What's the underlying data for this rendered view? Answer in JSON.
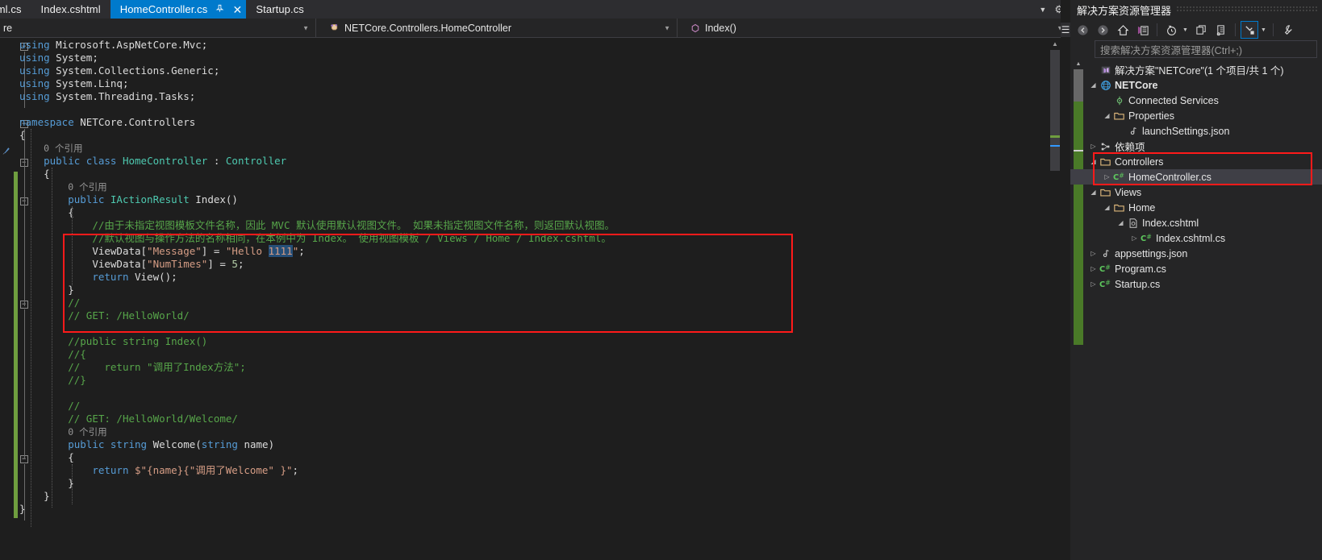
{
  "tabs": [
    {
      "label": "tml.cs",
      "active": false,
      "pinned": false,
      "closable": false
    },
    {
      "label": "Index.cshtml",
      "active": false,
      "pinned": false,
      "closable": false
    },
    {
      "label": "HomeController.cs",
      "active": true,
      "pinned": true,
      "closable": true
    },
    {
      "label": "Startup.cs",
      "active": false,
      "pinned": false,
      "closable": false
    }
  ],
  "tabstrip": {
    "overflow_caret": "chevron-down-icon",
    "gear": "gear-icon"
  },
  "navbar": {
    "project": "re",
    "type": "NETCore.Controllers.HomeController",
    "member": "Index()"
  },
  "code": {
    "lines": [
      {
        "indent": 0,
        "fold": true,
        "tokens": [
          {
            "c": "k",
            "t": "using"
          },
          {
            "c": "p",
            "t": " Microsoft.AspNetCore.Mvc;"
          }
        ]
      },
      {
        "indent": 0,
        "tokens": [
          {
            "c": "k",
            "t": "using"
          },
          {
            "c": "p",
            "t": " System;"
          }
        ]
      },
      {
        "indent": 0,
        "tokens": [
          {
            "c": "k",
            "t": "using"
          },
          {
            "c": "p",
            "t": " System.Collections.Generic;"
          }
        ]
      },
      {
        "indent": 0,
        "tokens": [
          {
            "c": "k",
            "t": "using"
          },
          {
            "c": "p",
            "t": " System.Linq;"
          }
        ]
      },
      {
        "indent": 0,
        "tokens": [
          {
            "c": "k",
            "t": "using"
          },
          {
            "c": "p",
            "t": " System.Threading.Tasks;"
          }
        ]
      },
      {
        "indent": 0,
        "tokens": []
      },
      {
        "indent": 0,
        "fold": true,
        "tokens": [
          {
            "c": "k",
            "t": "namespace"
          },
          {
            "c": "p",
            "t": " NETCore.Controllers"
          }
        ]
      },
      {
        "indent": 0,
        "tokens": [
          {
            "c": "p",
            "t": "{"
          }
        ]
      },
      {
        "indent": 1,
        "tokens": [
          {
            "c": "ref",
            "t": "0 个引用"
          }
        ]
      },
      {
        "indent": 1,
        "fold": true,
        "tokens": [
          {
            "c": "k",
            "t": "public"
          },
          {
            "c": "p",
            "t": " "
          },
          {
            "c": "k",
            "t": "class"
          },
          {
            "c": "p",
            "t": " "
          },
          {
            "c": "t",
            "t": "HomeController"
          },
          {
            "c": "p",
            "t": " : "
          },
          {
            "c": "t",
            "t": "Controller"
          }
        ]
      },
      {
        "indent": 1,
        "tokens": [
          {
            "c": "p",
            "t": "{"
          }
        ]
      },
      {
        "indent": 2,
        "tokens": [
          {
            "c": "ref",
            "t": "0 个引用"
          }
        ]
      },
      {
        "indent": 2,
        "tokens": [
          {
            "c": "k",
            "t": "public"
          },
          {
            "c": "p",
            "t": " "
          },
          {
            "c": "t",
            "t": "IActionResult"
          },
          {
            "c": "p",
            "t": " Index()"
          }
        ]
      },
      {
        "indent": 2,
        "tokens": [
          {
            "c": "p",
            "t": "{"
          }
        ]
      },
      {
        "indent": 3,
        "tokens": [
          {
            "c": "c",
            "t": "//由于未指定视图模板文件名称，因此 MVC 默认使用默认视图文件。 如果未指定视图文件名称，则返回默认视图。"
          }
        ]
      },
      {
        "indent": 3,
        "tokens": [
          {
            "c": "c",
            "t": "//默认视图与操作方法的名称相同，在本例中为 Index。 使用视图模板 / Views / Home / Index.cshtml。"
          }
        ]
      },
      {
        "indent": 3,
        "tokens": [
          {
            "c": "p",
            "t": "ViewData["
          },
          {
            "c": "s",
            "t": "\"Message\""
          },
          {
            "c": "p",
            "t": "] = "
          },
          {
            "c": "s",
            "t": "\"Hello "
          },
          {
            "c": "sel",
            "t": "1111"
          },
          {
            "c": "s",
            "t": "\""
          },
          {
            "c": "p",
            "t": ";"
          }
        ]
      },
      {
        "indent": 3,
        "tokens": [
          {
            "c": "p",
            "t": "ViewData["
          },
          {
            "c": "s",
            "t": "\"NumTimes\""
          },
          {
            "c": "p",
            "t": "] = "
          },
          {
            "c": "n",
            "t": "5"
          },
          {
            "c": "p",
            "t": ";"
          }
        ]
      },
      {
        "indent": 3,
        "tokens": [
          {
            "c": "k",
            "t": "return"
          },
          {
            "c": "p",
            "t": " View();"
          }
        ]
      },
      {
        "indent": 2,
        "tokens": [
          {
            "c": "p",
            "t": "}"
          }
        ]
      },
      {
        "indent": 2,
        "tokens": [
          {
            "c": "c",
            "t": "//"
          }
        ]
      },
      {
        "indent": 2,
        "tokens": [
          {
            "c": "c",
            "t": "// GET: /HelloWorld/"
          }
        ]
      },
      {
        "indent": 2,
        "tokens": []
      },
      {
        "indent": 2,
        "tokens": [
          {
            "c": "c",
            "t": "//public string Index()"
          }
        ]
      },
      {
        "indent": 2,
        "tokens": [
          {
            "c": "c",
            "t": "//{"
          }
        ]
      },
      {
        "indent": 2,
        "tokens": [
          {
            "c": "c",
            "t": "//    return \"调用了Index方法\";"
          }
        ]
      },
      {
        "indent": 2,
        "tokens": [
          {
            "c": "c",
            "t": "//}"
          }
        ]
      },
      {
        "indent": 2,
        "tokens": []
      },
      {
        "indent": 2,
        "tokens": [
          {
            "c": "c",
            "t": "//"
          }
        ]
      },
      {
        "indent": 2,
        "tokens": [
          {
            "c": "c",
            "t": "// GET: /HelloWorld/Welcome/"
          }
        ]
      },
      {
        "indent": 2,
        "tokens": [
          {
            "c": "ref",
            "t": "0 个引用"
          }
        ]
      },
      {
        "indent": 2,
        "fold": true,
        "tokens": [
          {
            "c": "k",
            "t": "public"
          },
          {
            "c": "p",
            "t": " "
          },
          {
            "c": "k",
            "t": "string"
          },
          {
            "c": "p",
            "t": " Welcome("
          },
          {
            "c": "k",
            "t": "string"
          },
          {
            "c": "p",
            "t": " name)"
          }
        ]
      },
      {
        "indent": 2,
        "tokens": [
          {
            "c": "p",
            "t": "{"
          }
        ]
      },
      {
        "indent": 3,
        "tokens": [
          {
            "c": "k",
            "t": "return"
          },
          {
            "c": "p",
            "t": " "
          },
          {
            "c": "s",
            "t": "$\"{name}{\"调用了Welcome\" }\""
          },
          {
            "c": "p",
            "t": ";"
          }
        ]
      },
      {
        "indent": 2,
        "tokens": [
          {
            "c": "p",
            "t": "}"
          }
        ]
      },
      {
        "indent": 1,
        "tokens": [
          {
            "c": "p",
            "t": "}"
          }
        ]
      },
      {
        "indent": 0,
        "tokens": [
          {
            "c": "p",
            "t": "}"
          }
        ]
      }
    ],
    "highlight_box_label": "red-annotation-rectangle"
  },
  "solution_explorer": {
    "title": "解决方案资源管理器",
    "search_placeholder": "搜索解决方案资源管理器(Ctrl+;)",
    "toolbar": [
      {
        "name": "back-icon",
        "glyph": "←"
      },
      {
        "name": "forward-icon",
        "glyph": "→"
      },
      {
        "name": "home-icon",
        "glyph": "⌂"
      },
      {
        "name": "solution-explorer-icon",
        "glyph": "▤"
      },
      {
        "name": "pending-changes-icon",
        "glyph": "◴"
      },
      {
        "name": "show-all-files-icon",
        "glyph": "⧉"
      },
      {
        "name": "refresh-icon",
        "glyph": "❐"
      },
      {
        "name": "collapse-all-icon",
        "glyph": "↘"
      },
      {
        "name": "properties-icon",
        "glyph": "⚒"
      }
    ],
    "tree": [
      {
        "depth": 0,
        "twisty": "",
        "icon": "solution-icon",
        "label": "解决方案\"NETCore\"(1 个项目/共 1 个)",
        "bold": false,
        "selected": false,
        "boxed": false
      },
      {
        "depth": 0,
        "twisty": "◢",
        "icon": "project-web-icon",
        "label": "NETCore",
        "bold": true,
        "selected": false,
        "boxed": false
      },
      {
        "depth": 1,
        "twisty": "",
        "icon": "connected-services-icon",
        "label": "Connected Services",
        "bold": false,
        "selected": false,
        "boxed": false
      },
      {
        "depth": 1,
        "twisty": "◢",
        "icon": "folder-icon",
        "label": "Properties",
        "bold": false,
        "selected": false,
        "boxed": false
      },
      {
        "depth": 2,
        "twisty": "",
        "icon": "json-file-icon",
        "label": "launchSettings.json",
        "bold": false,
        "selected": false,
        "boxed": false
      },
      {
        "depth": 0,
        "twisty": "▷",
        "icon": "dependencies-icon",
        "label": "依赖项",
        "bold": false,
        "selected": false,
        "boxed": false
      },
      {
        "depth": 0,
        "twisty": "◢",
        "icon": "folder-icon",
        "label": "Controllers",
        "bold": false,
        "selected": false,
        "boxed": true
      },
      {
        "depth": 1,
        "twisty": "▷",
        "icon": "csharp-file-icon",
        "label": "HomeController.cs",
        "bold": false,
        "selected": true,
        "boxed": true
      },
      {
        "depth": 0,
        "twisty": "◢",
        "icon": "folder-icon",
        "label": "Views",
        "bold": false,
        "selected": false,
        "boxed": false
      },
      {
        "depth": 1,
        "twisty": "◢",
        "icon": "folder-icon",
        "label": "Home",
        "bold": false,
        "selected": false,
        "boxed": false
      },
      {
        "depth": 2,
        "twisty": "◢",
        "icon": "cshtml-file-icon",
        "label": "Index.cshtml",
        "bold": false,
        "selected": false,
        "boxed": false
      },
      {
        "depth": 3,
        "twisty": "▷",
        "icon": "csharp-file-icon",
        "label": "Index.cshtml.cs",
        "bold": false,
        "selected": false,
        "boxed": false
      },
      {
        "depth": 0,
        "twisty": "▷",
        "icon": "json-file-icon",
        "label": "appsettings.json",
        "bold": false,
        "selected": false,
        "boxed": false
      },
      {
        "depth": 0,
        "twisty": "▷",
        "icon": "csharp-file-icon",
        "label": "Program.cs",
        "bold": false,
        "selected": false,
        "boxed": false
      },
      {
        "depth": 0,
        "twisty": "▷",
        "icon": "csharp-file-icon",
        "label": "Startup.cs",
        "bold": false,
        "selected": false,
        "boxed": false
      }
    ]
  },
  "colors": {
    "accent": "#007acc",
    "annotation": "#ff1a1a",
    "comment": "#57a64a",
    "keyword": "#569cd6",
    "type": "#4ec9b0",
    "string": "#d69d85",
    "selection": "#264f78",
    "change_bar": "#6f9e3f"
  }
}
